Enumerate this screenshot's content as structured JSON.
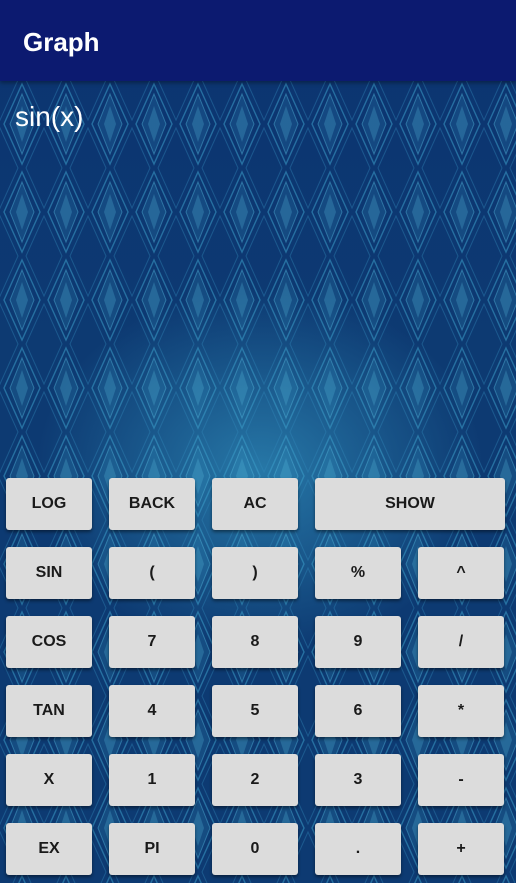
{
  "app_bar": {
    "title": "Graph"
  },
  "display": {
    "expression": "sin(x)"
  },
  "keypad": {
    "log": "LOG",
    "back": "BACK",
    "ac": "AC",
    "show": "SHOW",
    "sin": "SIN",
    "lparen": "(",
    "rparen": ")",
    "percent": "%",
    "pow": "^",
    "cos": "COS",
    "k7": "7",
    "k8": "8",
    "k9": "9",
    "div": "/",
    "tan": "TAN",
    "k4": "4",
    "k5": "5",
    "k6": "6",
    "mul": "*",
    "x": "X",
    "k1": "1",
    "k2": "2",
    "k3": "3",
    "minus": "-",
    "ex": "EX",
    "pi": "PI",
    "k0": "0",
    "dot": ".",
    "plus": "+"
  },
  "colors": {
    "app_bar": "#0c1a70",
    "background": "#0d3a72",
    "pattern": "#3a9cc8",
    "key": "#dcdcdc",
    "key_text": "#1a1a1a"
  }
}
